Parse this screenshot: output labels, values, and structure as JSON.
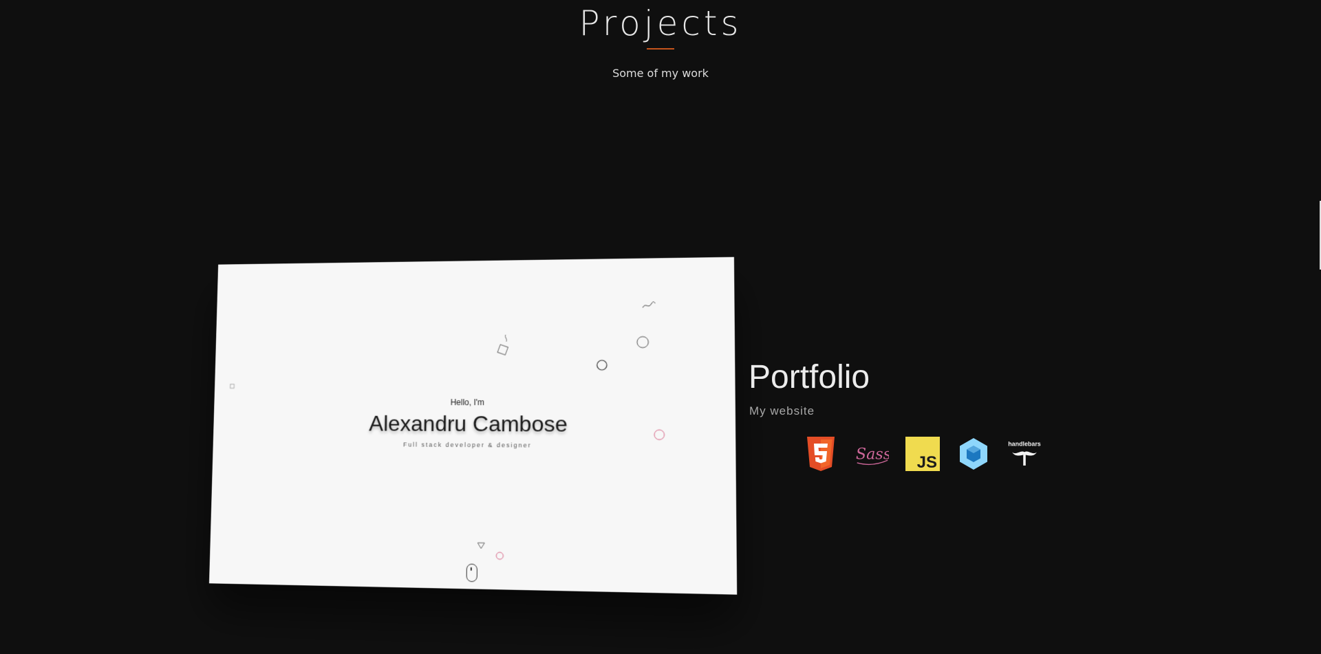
{
  "section": {
    "title": "Projects",
    "subtitle": "Some of my work",
    "accent_color": "#c6541c"
  },
  "project": {
    "name": "Portfolio",
    "description": "My website",
    "preview": {
      "greeting": "Hello, I'm",
      "name": "Alexandru Cambose",
      "role": "Full stack developer & designer"
    },
    "technologies": [
      {
        "name": "html5",
        "icon": "html5-icon"
      },
      {
        "name": "sass",
        "icon": "sass-icon",
        "label": "Sass"
      },
      {
        "name": "javascript",
        "icon": "javascript-icon",
        "label": "JS"
      },
      {
        "name": "webpack",
        "icon": "webpack-icon"
      },
      {
        "name": "handlebars",
        "icon": "handlebars-icon",
        "label": "handlebars"
      }
    ]
  }
}
